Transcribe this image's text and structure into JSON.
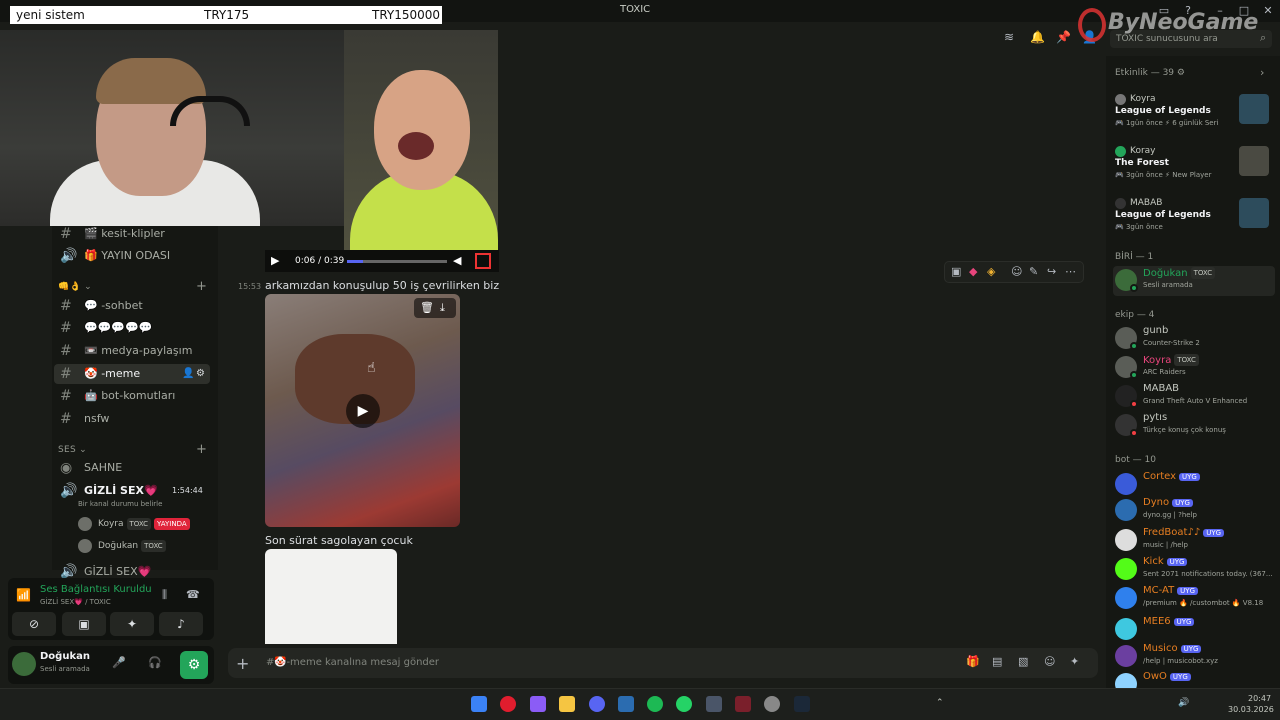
{
  "window": {
    "title": "TOXIC"
  },
  "overlay": {
    "label": "yeni sistem",
    "value1": "TRY175",
    "value2": "TRY150000"
  },
  "watermark": "ByNeoGame",
  "header": {
    "search_placeholder": "TOXIC sunucusunu ara"
  },
  "channels": {
    "items": [
      {
        "name": "🎬 kesit-klipler",
        "type": "text"
      },
      {
        "name": "🎁 YAYIN ODASI",
        "type": "voice"
      }
    ],
    "category2": "👊👌",
    "items2": [
      {
        "name": "💬 -sohbet"
      },
      {
        "name": "💬💬💬💬💬"
      },
      {
        "name": "📼 medya-paylaşım"
      },
      {
        "name": "🤡 -meme",
        "active": true
      },
      {
        "name": "🤖 bot-komutları"
      },
      {
        "name": "nsfw"
      }
    ],
    "voice_section": "SES",
    "stage": "SAHNE",
    "voice_channel": "GİZLİ SEX💗",
    "voice_timer": "1:54:44",
    "voice_status": "Bir kanal durumu belirle",
    "voice_users": [
      {
        "name": "Koyra",
        "badge": "TOXC",
        "live": "YAYINDA"
      },
      {
        "name": "Doğukan",
        "badge": "TOXC"
      }
    ],
    "voice_channel2": "GİZLİ SEX💗"
  },
  "voice_panel": {
    "status": "Ses Bağlantısı Kuruldu",
    "channel": "GİZLİ SEX💗 / TOXIC"
  },
  "user_panel": {
    "name": "Doğukan",
    "status": "Sesli aramada"
  },
  "chat": {
    "video_time": "0:06 / 0:39",
    "messages": [
      {
        "time": "15:53",
        "text": "arkamızdan konuşulup 50 iş çevrilirken biz"
      },
      {
        "time": "",
        "text": "Son sürat sagolayan çocuk"
      }
    ],
    "input_placeholder": "🤡-meme kanalına mesaj gönder"
  },
  "members": {
    "activity_header": "Etkinlik — 39",
    "activities": [
      {
        "user": "Koyra",
        "game": "League of Legends",
        "meta1": "1gün önce",
        "meta2": "6 günlük Seri"
      },
      {
        "user": "Koray",
        "game": "The Forest",
        "meta1": "3gün önce",
        "meta2": "New Player"
      },
      {
        "user": "MABAB",
        "game": "League of Legends",
        "meta1": "3gün önce",
        "meta2": ""
      }
    ],
    "group1": "BİRİ — 1",
    "group1_members": [
      {
        "name": "Doğukan",
        "badge": "TOXC",
        "status": "Sesli aramada"
      }
    ],
    "group2": "ekip — 4",
    "group2_members": [
      {
        "name": "gunb",
        "status": "Counter-Strike 2"
      },
      {
        "name": "Koyra",
        "badge": "TOXC",
        "status": "ARC Raiders"
      },
      {
        "name": "MABAB",
        "status": "Grand Theft Auto V Enhanced"
      },
      {
        "name": "pytıs",
        "status": "Türkçe konuş çok konuş"
      }
    ],
    "group3": "bot — 10",
    "bots": [
      {
        "name": "Cortex",
        "tag": "UYG",
        "status": ""
      },
      {
        "name": "Dyno",
        "tag": "UYG",
        "status": "dyno.gg | ?help"
      },
      {
        "name": "FredBoat♪♪",
        "tag": "UYG",
        "status": "music | /help"
      },
      {
        "name": "Kick",
        "tag": "UYG",
        "status": "Sent 2071 notifications today. (367..."
      },
      {
        "name": "MC-AT",
        "tag": "UYG",
        "status": "/premium 🔥 /custombot 🔥 V8.18"
      },
      {
        "name": "MEE6",
        "tag": "UYG",
        "status": ""
      },
      {
        "name": "Musico",
        "tag": "UYG",
        "status": "/help | musicobot.xyz"
      },
      {
        "name": "OwO",
        "tag": "UYG",
        "status": ""
      }
    ]
  },
  "taskbar": {
    "time": "20:47",
    "date": "30.03.2026"
  },
  "colors": {
    "accent": "#5865f2",
    "live": "#e0243a",
    "online": "#23a55a",
    "dnd": "#f23f43"
  }
}
